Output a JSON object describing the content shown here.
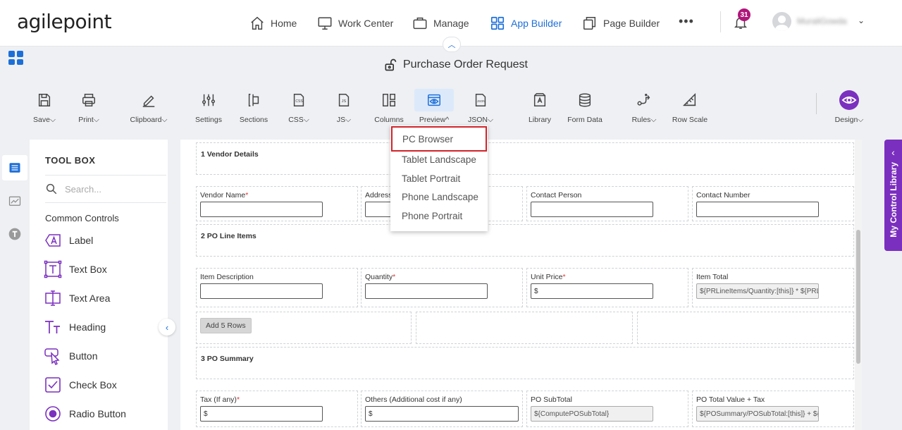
{
  "app": {
    "logo_text": "agilepoint",
    "form_title": "Purchase Order Request",
    "nav": [
      {
        "label": "Home",
        "active": false
      },
      {
        "label": "Work Center",
        "active": false
      },
      {
        "label": "Manage",
        "active": false
      },
      {
        "label": "App Builder",
        "active": true
      },
      {
        "label": "Page Builder",
        "active": false
      }
    ],
    "more_label": "•••",
    "notifications_count": "31",
    "username": "MuraliGowda",
    "user_chevron": "⌄",
    "collapse_glyph": "︿"
  },
  "toolbar": {
    "items": [
      {
        "label": "Save",
        "icon": "save-icon",
        "caret": "down"
      },
      {
        "label": "Print",
        "icon": "print-icon",
        "caret": "down"
      },
      {
        "label": "Clipboard",
        "icon": "pencil-icon",
        "caret": "down"
      },
      {
        "label": "Settings",
        "icon": "sliders-icon",
        "caret": ""
      },
      {
        "label": "Sections",
        "icon": "sections-icon",
        "caret": ""
      },
      {
        "label": "CSS",
        "icon": "css-file-icon",
        "caret": "down"
      },
      {
        "label": "JS",
        "icon": "js-file-icon",
        "caret": "down"
      },
      {
        "label": "Columns",
        "icon": "columns-icon",
        "caret": ""
      },
      {
        "label": "Preview",
        "icon": "eye-icon",
        "caret": "up"
      },
      {
        "label": "JSON",
        "icon": "json-file-icon",
        "caret": "down"
      },
      {
        "label": "Library",
        "icon": "library-icon",
        "caret": ""
      },
      {
        "label": "Form Data",
        "icon": "database-icon",
        "caret": ""
      },
      {
        "label": "Rules",
        "icon": "rules-icon",
        "caret": "down"
      },
      {
        "label": "Row Scale",
        "icon": "row-scale-icon",
        "caret": ""
      },
      {
        "label": "Design",
        "icon": "design-eye-icon",
        "caret": "down"
      }
    ]
  },
  "preview_menu": {
    "items": [
      "PC Browser",
      "Tablet Landscape",
      "Tablet Portrait",
      "Phone Landscape",
      "Phone Portrait"
    ],
    "highlighted": "PC Browser"
  },
  "toolbox": {
    "title": "TOOL BOX",
    "search_placeholder": "Search...",
    "section": "Common Controls",
    "controls": [
      {
        "label": "Label",
        "icon": "label-icon"
      },
      {
        "label": "Text Box",
        "icon": "text-box-icon"
      },
      {
        "label": "Text Area",
        "icon": "text-area-icon"
      },
      {
        "label": "Heading",
        "icon": "heading-icon"
      },
      {
        "label": "Button",
        "icon": "button-cursor-icon"
      },
      {
        "label": "Check Box",
        "icon": "checkbox-icon"
      },
      {
        "label": "Radio Button",
        "icon": "radio-icon"
      }
    ],
    "collapse_glyph": "‹"
  },
  "form": {
    "sections": [
      {
        "title": "1 Vendor Details",
        "fields": [
          {
            "label": "Vendor Name",
            "required": true,
            "value": "",
            "readonly": false
          },
          {
            "label": "Address",
            "required": false,
            "value": "",
            "readonly": false
          },
          {
            "label": "Contact Person",
            "required": false,
            "value": "",
            "readonly": false
          },
          {
            "label": "Contact Number",
            "required": false,
            "value": "",
            "readonly": false
          }
        ]
      },
      {
        "title": "2 PO Line Items",
        "fields": [
          {
            "label": "Item Description",
            "required": false,
            "value": "",
            "readonly": false
          },
          {
            "label": "Quantity",
            "required": true,
            "value": "",
            "readonly": false
          },
          {
            "label": "Unit Price",
            "required": true,
            "value": "$",
            "readonly": false
          },
          {
            "label": "Item Total",
            "required": false,
            "value": "${PRLineItems/Quantity:[this]} * ${PRLineItems/UnitPrice:[this]}",
            "readonly": true
          }
        ],
        "add_rows_label": "Add 5 Rows"
      },
      {
        "title": "3 PO Summary",
        "fields": [
          {
            "label": "Tax (If any)",
            "required": true,
            "value": "$",
            "readonly": false
          },
          {
            "label": "Others (Additional cost if any)",
            "required": false,
            "value": "$",
            "readonly": false
          },
          {
            "label": "PO SubTotal",
            "required": false,
            "value": "${ComputePOSubTotal}",
            "readonly": true
          },
          {
            "label": "PO Total Value + Tax",
            "required": false,
            "value": "${POSummary/POSubTotal:[this]} + ${POSummary/Tax:[this]}",
            "readonly": true
          }
        ]
      }
    ]
  },
  "right_panel": {
    "label": "My Control Library",
    "glyph": "‹"
  },
  "colors": {
    "accent": "#1d6fd8",
    "brand_purple": "#7b2fbf",
    "badge": "#b0157a",
    "highlight_border": "#d0232a"
  }
}
